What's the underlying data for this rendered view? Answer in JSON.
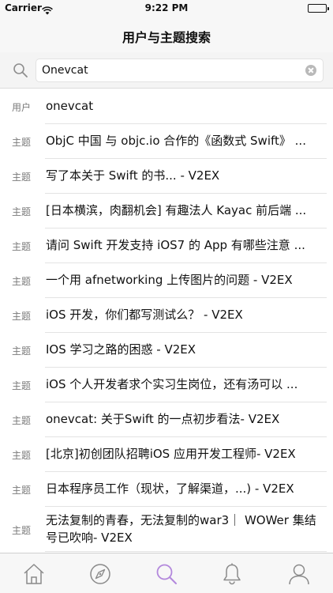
{
  "status_bar": {
    "carrier": "Carrier",
    "time": "9:22 PM"
  },
  "nav": {
    "title": "用户与主题搜索"
  },
  "search": {
    "value": "Onevcat"
  },
  "results": [
    {
      "kind": "用户",
      "text": "onevcat"
    },
    {
      "kind": "主题",
      "text": "ObjC 中国 与 objc.io 合作的《函数式 Swift》 ..."
    },
    {
      "kind": "主题",
      "text": "写了本关于 Swift 的书... - V2EX"
    },
    {
      "kind": "主题",
      "text": "[日本横滨，肉翻机会] 有趣法人 Kayac 前后端 ..."
    },
    {
      "kind": "主题",
      "text": "请问 Swift 开发支持 iOS7 的 App 有哪些注意 ..."
    },
    {
      "kind": "主题",
      "text": "一个用 afnetworking 上传图片的问题 - V2EX"
    },
    {
      "kind": "主题",
      "text": "iOS 开发，你们都写测试么？ - V2EX"
    },
    {
      "kind": "主题",
      "text": "IOS 学习之路的困惑 - V2EX"
    },
    {
      "kind": "主题",
      "text": "iOS 个人开发者求个实习生岗位，还有汤可以 ..."
    },
    {
      "kind": "主题",
      "text": "onevcat: 关于Swift 的一点初步看法- V2EX"
    },
    {
      "kind": "主题",
      "text": "[北京]初创团队招聘iOS 应用开发工程师- V2EX"
    },
    {
      "kind": "主题",
      "text": "日本程序员工作（现状，了解渠道，...) - V2EX"
    },
    {
      "kind": "主题",
      "text": "无法复制的青春，无法复制的war3｜ WOWer 集结号已吹响- V2EX"
    }
  ],
  "tabs": [
    {
      "icon": "home-icon",
      "active": false
    },
    {
      "icon": "compass-icon",
      "active": false
    },
    {
      "icon": "search-icon",
      "active": true
    },
    {
      "icon": "bell-icon",
      "active": false
    },
    {
      "icon": "profile-icon",
      "active": false
    }
  ],
  "colors": {
    "accent": "#b388dc",
    "inactive_tab": "#8a8a8a"
  }
}
